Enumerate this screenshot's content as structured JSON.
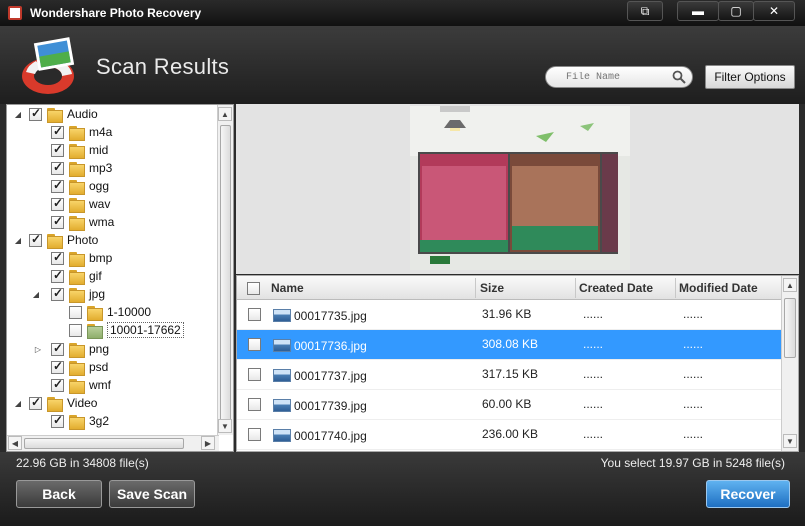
{
  "window": {
    "title": "Wondershare Photo Recovery",
    "buttons": {
      "restore": "⧉",
      "minimize": "▬",
      "maximize": "▢",
      "close": "✕"
    }
  },
  "header": {
    "title": "Scan Results",
    "search_placeholder": "File Name",
    "filter_label": "Filter Options"
  },
  "tree": {
    "items": [
      {
        "label": "Audio",
        "checked": true,
        "expanded": true
      },
      {
        "label": "m4a",
        "checked": true
      },
      {
        "label": "mid",
        "checked": true
      },
      {
        "label": "mp3",
        "checked": true
      },
      {
        "label": "ogg",
        "checked": true
      },
      {
        "label": "wav",
        "checked": true
      },
      {
        "label": "wma",
        "checked": true
      },
      {
        "label": "Photo",
        "checked": true,
        "expanded": true
      },
      {
        "label": "bmp",
        "checked": true
      },
      {
        "label": "gif",
        "checked": true
      },
      {
        "label": "jpg",
        "checked": true,
        "expanded": true
      },
      {
        "label": "1-10000",
        "checked": false
      },
      {
        "label": "10001-17662",
        "checked": false,
        "selected": true
      },
      {
        "label": "png",
        "checked": true,
        "collapsed": true
      },
      {
        "label": "psd",
        "checked": true
      },
      {
        "label": "wmf",
        "checked": true
      },
      {
        "label": "Video",
        "checked": true,
        "expanded": true
      },
      {
        "label": "3g2",
        "checked": true
      }
    ]
  },
  "list": {
    "columns": {
      "name": "Name",
      "size": "Size",
      "created": "Created Date",
      "modified": "Modified Date"
    },
    "rows": [
      {
        "name": "00017735.jpg",
        "size": "31.96 KB",
        "created": "......",
        "modified": "......"
      },
      {
        "name": "00017736.jpg",
        "size": "308.08 KB",
        "created": "......",
        "modified": "......",
        "selected": true
      },
      {
        "name": "00017737.jpg",
        "size": "317.15 KB",
        "created": "......",
        "modified": "......"
      },
      {
        "name": "00017739.jpg",
        "size": "60.00 KB",
        "created": "......",
        "modified": "......"
      },
      {
        "name": "00017740.jpg",
        "size": "236.00 KB",
        "created": "......",
        "modified": "......"
      }
    ]
  },
  "status": {
    "left": "22.96 GB in 34808 file(s)",
    "right": "You select 19.97 GB in 5248 file(s)"
  },
  "buttons": {
    "back": "Back",
    "save_scan": "Save Scan",
    "recover": "Recover"
  }
}
